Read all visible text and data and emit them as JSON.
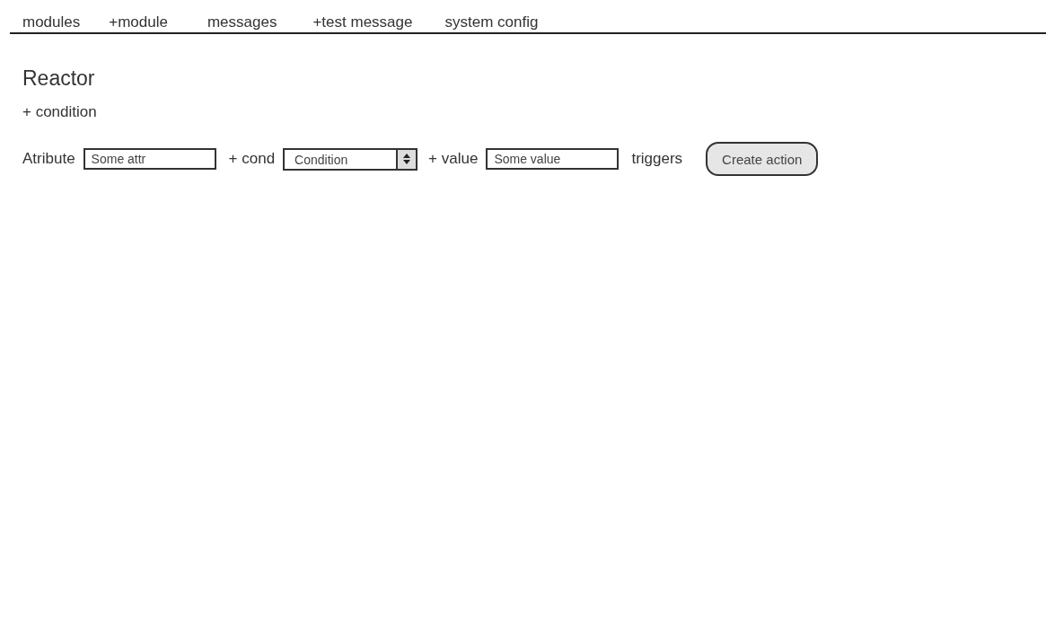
{
  "nav": [
    {
      "label": "modules"
    },
    {
      "label": "+module"
    },
    {
      "label": "messages"
    },
    {
      "label": "+test message"
    },
    {
      "label": "system config"
    }
  ],
  "title": "Reactor",
  "add_condition": "+ condition",
  "condition_row": [
    {
      "kind": "label",
      "text": "Atribute"
    },
    {
      "kind": "field",
      "placeholder": "Some attr"
    },
    {
      "kind": "label",
      "text": "+ cond"
    },
    {
      "kind": "select",
      "value": "Condition"
    },
    {
      "kind": "label",
      "text": "+ value"
    },
    {
      "kind": "field",
      "placeholder": "Some value"
    },
    {
      "kind": "label",
      "text": "triggers"
    },
    {
      "kind": "button",
      "label": "Create action"
    }
  ]
}
